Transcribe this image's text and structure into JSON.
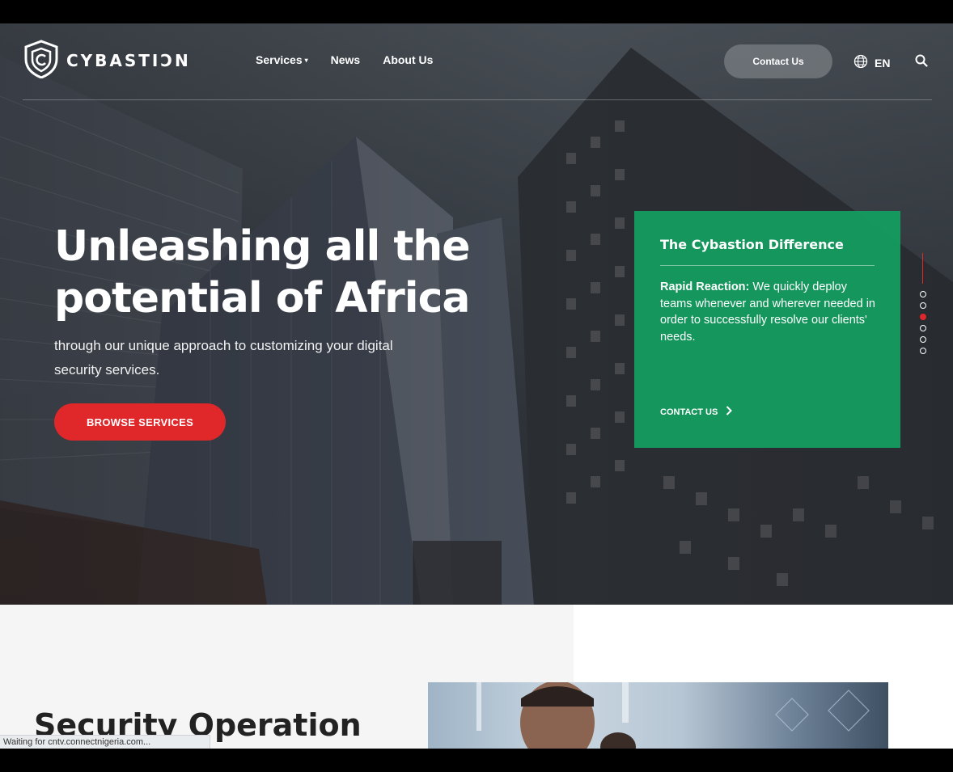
{
  "header": {
    "logo_text": "CYBASTIƆN",
    "nav": [
      {
        "label": "Services",
        "has_dropdown": true
      },
      {
        "label": "News"
      },
      {
        "label": "About Us"
      }
    ],
    "contact_label": "Contact Us",
    "language": "EN",
    "icons": {
      "language": "globe-icon",
      "search": "search-icon",
      "logo": "shield-logo-icon"
    }
  },
  "hero": {
    "title": "Unleashing all the potential of Africa",
    "subtitle": "through our unique approach to customizing your digital security services.",
    "cta_label": "BROWSE SERVICES",
    "colors": {
      "cta": "#e0272a",
      "card": "#12a060"
    }
  },
  "card": {
    "title": "The Cybastion Difference",
    "body_bold": "Rapid Reaction:",
    "body_text": " We quickly deploy teams whenever and wherever needed in order to successfully resolve our clients' needs.",
    "link_label": "CONTACT US",
    "link_icon": "chevron-right-icon"
  },
  "slider": {
    "total": 6,
    "active_index": 2
  },
  "section": {
    "title": "Security Operation"
  },
  "status_bar": {
    "text": "Waiting for cntv.connectnigeria.com..."
  }
}
